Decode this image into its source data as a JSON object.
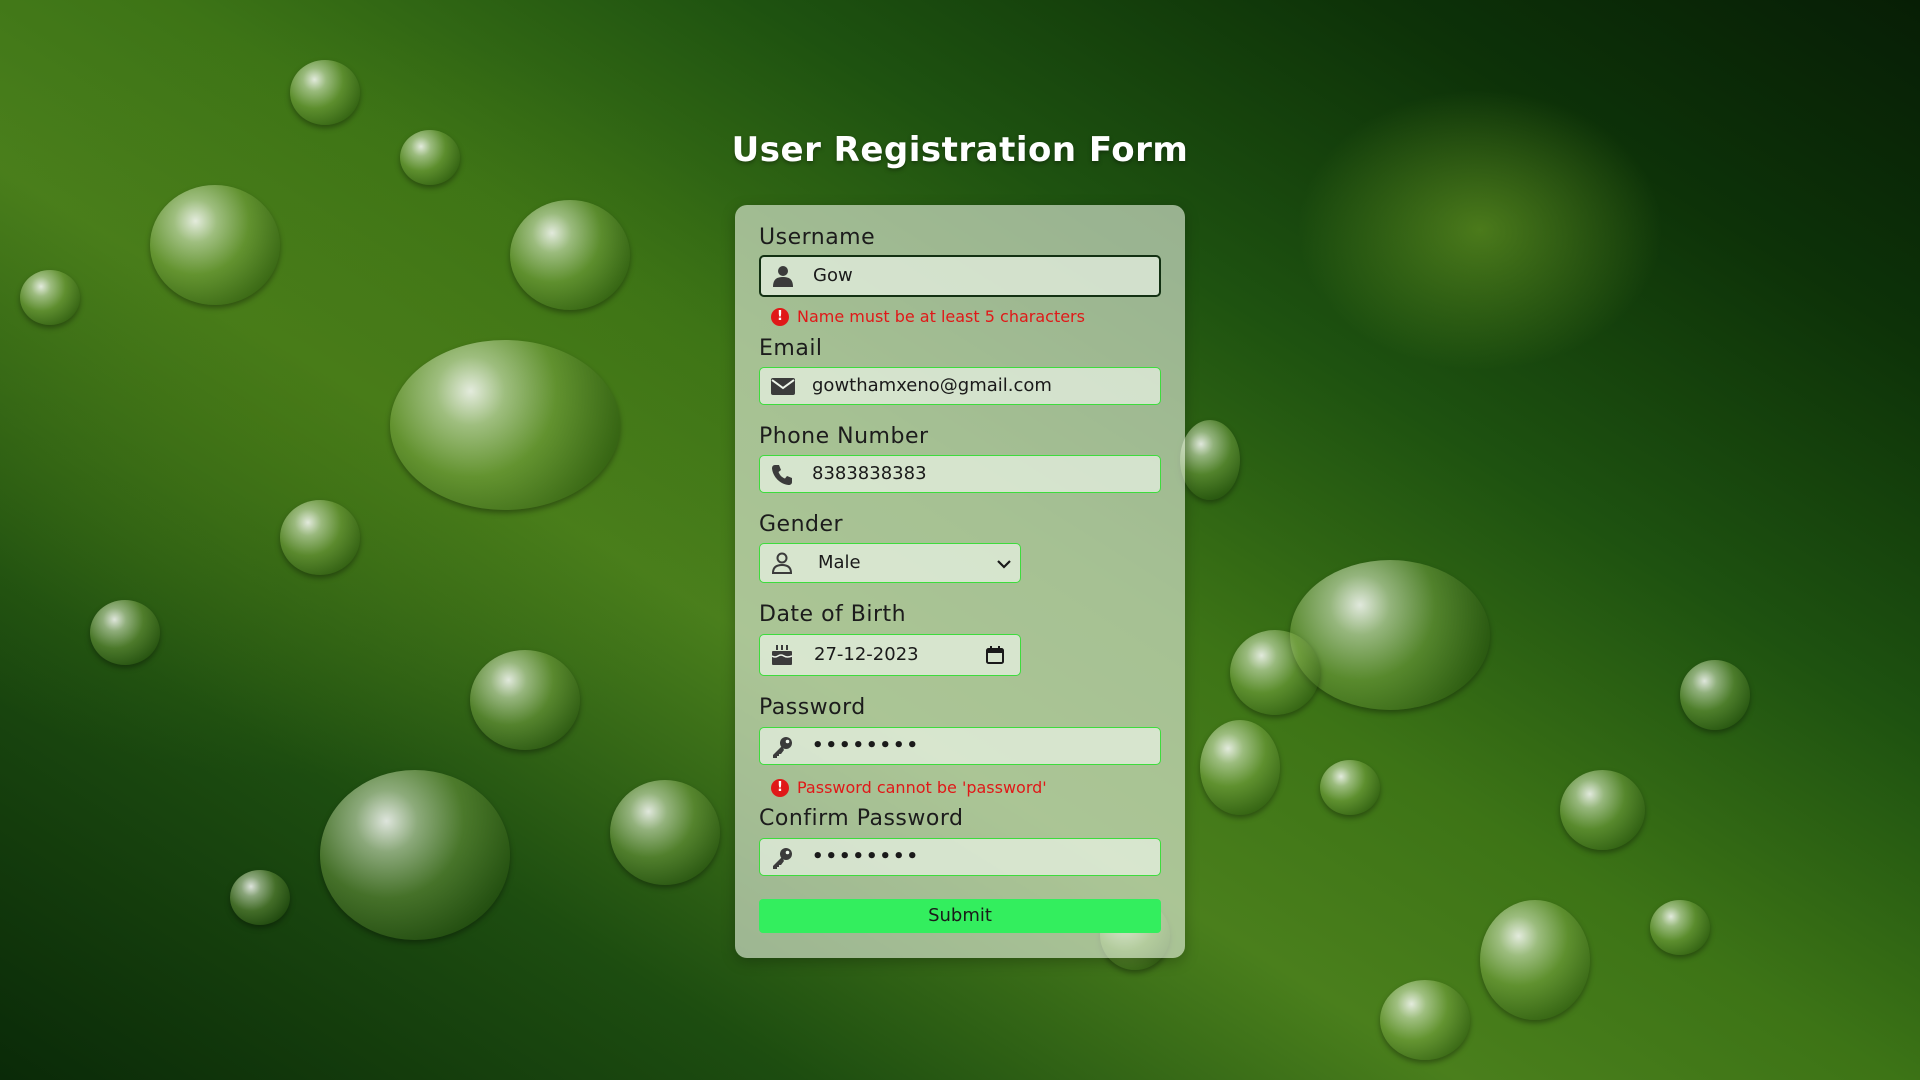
{
  "page": {
    "title": "User Registration Form"
  },
  "form": {
    "username": {
      "label": "Username",
      "value": "Gow",
      "error": "Name must be at least 5 characters"
    },
    "email": {
      "label": "Email",
      "value": "gowthamxeno@gmail.com"
    },
    "phone": {
      "label": "Phone Number",
      "value": "8383838383"
    },
    "gender": {
      "label": "Gender",
      "value": "Male"
    },
    "dob": {
      "label": "Date of Birth",
      "value": "27-12-2023"
    },
    "password": {
      "label": "Password",
      "value": "••••••••",
      "error": "Password cannot be 'password'"
    },
    "confirm_password": {
      "label": "Confirm Password",
      "value": "••••••••"
    },
    "submit_label": "Submit"
  },
  "colors": {
    "accent": "#33ee5e",
    "field_border": "#3ddc3d",
    "error": "#e01818"
  },
  "icons": {
    "username": "user-icon",
    "email": "envelope-icon",
    "phone": "phone-icon",
    "gender": "user-outline-icon",
    "dob": "birthday-cake-icon",
    "password": "key-icon",
    "confirm_password": "key-icon",
    "error": "exclamation-circle-icon",
    "dropdown": "chevron-down-icon",
    "calendar": "calendar-icon"
  }
}
